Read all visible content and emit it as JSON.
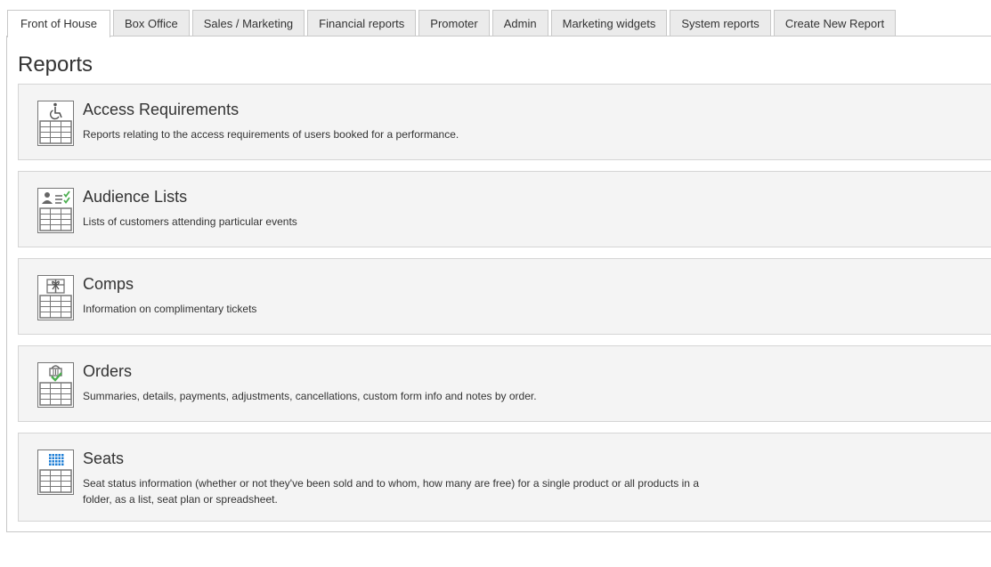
{
  "tabs": [
    {
      "label": "Front of House",
      "active": true
    },
    {
      "label": "Box Office",
      "active": false
    },
    {
      "label": "Sales / Marketing",
      "active": false
    },
    {
      "label": "Financial reports",
      "active": false
    },
    {
      "label": "Promoter",
      "active": false
    },
    {
      "label": "Admin",
      "active": false
    },
    {
      "label": "Marketing widgets",
      "active": false
    },
    {
      "label": "System reports",
      "active": false
    },
    {
      "label": "Create New Report",
      "active": false
    }
  ],
  "page": {
    "title": "Reports"
  },
  "reports": [
    {
      "title": "Access Requirements",
      "description": "Reports relating to the access requirements of users booked for a performance.",
      "icon": "wheelchair-table-icon"
    },
    {
      "title": "Audience Lists",
      "description": "Lists of customers attending particular events",
      "icon": "user-checklist-table-icon"
    },
    {
      "title": "Comps",
      "description": "Information on complimentary tickets",
      "icon": "gift-table-icon"
    },
    {
      "title": "Orders",
      "description": "Summaries, details, payments, adjustments, cancellations, custom form info and notes by order.",
      "icon": "basket-check-table-icon"
    },
    {
      "title": "Seats",
      "description": "Seat status information (whether or not they've been sold and to whom, how many are free) for a single product or all products in a folder, as a list, seat plan or spreadsheet.",
      "icon": "seat-grid-table-icon"
    }
  ],
  "colors": {
    "icon_grey": "#777777",
    "check_green": "#4caf50",
    "seat_blue": "#1f7fd6",
    "card_background": "#f4f4f4"
  }
}
